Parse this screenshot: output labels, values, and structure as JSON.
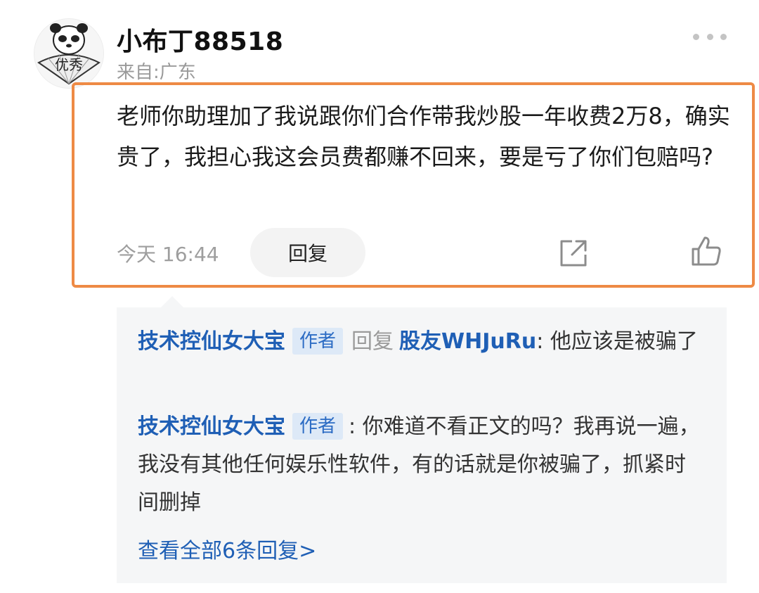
{
  "comment": {
    "username": "小布丁88518",
    "location": "来自:广东",
    "avatar_text": "优秀",
    "text": "老师你助理加了我说跟你们合作带我炒股一年收费2万8，确实贵了，我担心我这会员费都赚不回来，要是亏了你们包赔吗?",
    "time": "今天 16:44",
    "reply_label": "回复",
    "more_icon": "more-dots-icon",
    "share_icon": "share-icon",
    "like_icon": "thumbs-up-icon",
    "highlight_color": "#ee8a45"
  },
  "replies": {
    "items": [
      {
        "author": "技术控仙女大宝",
        "badge": "作者",
        "reply_word": "回复",
        "target": "股友WHJuRu",
        "text": ": 他应该是被骗了"
      },
      {
        "author": "技术控仙女大宝",
        "badge": "作者",
        "text": ": 你难道不看正文的吗？我再说一遍，我没有其他任何娱乐性软件，有的话就是你被骗了，抓紧时间删掉"
      }
    ],
    "view_all": "查看全部6条回复>",
    "link_color": "#1f5fb5"
  }
}
